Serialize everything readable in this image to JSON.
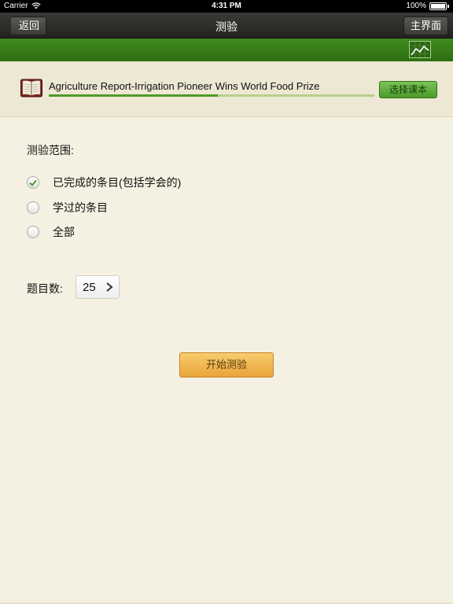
{
  "status_bar": {
    "carrier": "Carrier",
    "time": "4:31 PM",
    "battery": "100%"
  },
  "nav": {
    "back_label": "返回",
    "title": "测验",
    "main_label": "主界面"
  },
  "book": {
    "title": "Agriculture Report-Irrigation Pioneer Wins World Food Prize",
    "progress": 0.52,
    "select_label": "选择课本"
  },
  "quiz": {
    "range_label": "测验范围:",
    "options": [
      {
        "label": "已完成的条目(包括学会的)",
        "selected": true
      },
      {
        "label": "学过的条目",
        "selected": false
      },
      {
        "label": "全部",
        "selected": false
      }
    ],
    "count_label": "题目数:",
    "count_value": "25",
    "start_label": "开始测验"
  },
  "colors": {
    "nav_bar": "#2e2e2b",
    "green_bar": "#367d18",
    "accent_green": "#4f9a28",
    "start_button": "#f0b650",
    "background": "#f5f1e2"
  },
  "icons": {
    "wifi": "wifi-icon",
    "book": "book-icon",
    "chart": "stats-chart-icon",
    "chevron": "chevron-right-icon",
    "check": "check-icon"
  }
}
